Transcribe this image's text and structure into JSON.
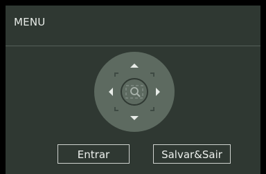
{
  "menu": {
    "title": "MENU"
  },
  "dpad": {
    "center_icon": "zoom-icon"
  },
  "buttons": {
    "enter_label": "Entrar",
    "save_exit_label": "Salvar&Sair"
  },
  "colors": {
    "panel_bg": "#2f3832",
    "dpad_fill": "#5d6a60"
  }
}
